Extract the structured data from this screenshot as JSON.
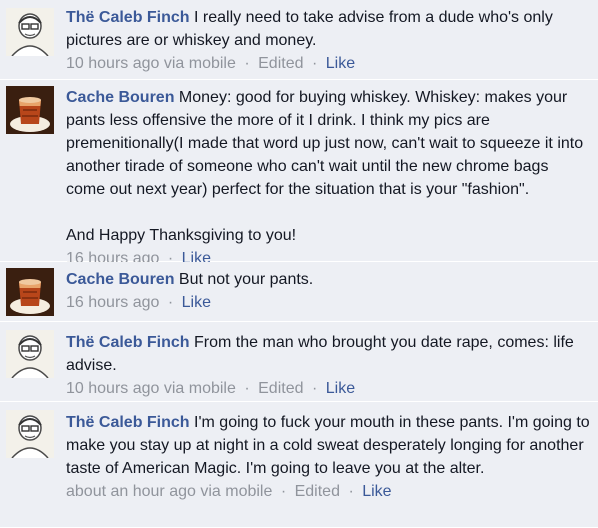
{
  "comments": [
    {
      "author": "Thë Caleb Finch",
      "avatar": "sketch-portrait",
      "text": "I really need to take advise from a dude who's only pictures are or whiskey and money.",
      "time": "10 hours ago via mobile",
      "edited": "Edited",
      "like": "Like",
      "sep": "·"
    },
    {
      "author": "Cache Bouren",
      "avatar": "whiskey-glass",
      "text": "Money: good for buying whiskey. Whiskey: makes your pants less offensive the more of it I drink. I think my pics are premenitionally(I made that word up just now, can't wait to squeeze it into another tirade of someone who can't wait until the new chrome bags come out next year) perfect for the situation that is your \"fashion\".\n\nAnd Happy Thanksgiving to you!",
      "time": "16 hours ago",
      "like": "Like",
      "sep": "·"
    },
    {
      "author": "Cache Bouren",
      "avatar": "whiskey-glass",
      "text": "But not your pants.",
      "time": "16 hours ago",
      "like": "Like",
      "sep": "·"
    },
    {
      "author": "Thë Caleb Finch",
      "avatar": "sketch-portrait",
      "text": "From the man who brought you date rape, comes: life advise.",
      "time": "10 hours ago via mobile",
      "edited": "Edited",
      "like": "Like",
      "sep": "·"
    },
    {
      "author": "Thë Caleb Finch",
      "avatar": "sketch-portrait",
      "text": "I'm going to fuck your mouth in these pants. I'm going to make you stay up at night in a cold sweat desperately longing for another taste of American Magic. I'm going to leave you at the alter.",
      "time": "about an hour ago via mobile",
      "edited": "Edited",
      "like": "Like",
      "sep": "·"
    }
  ]
}
